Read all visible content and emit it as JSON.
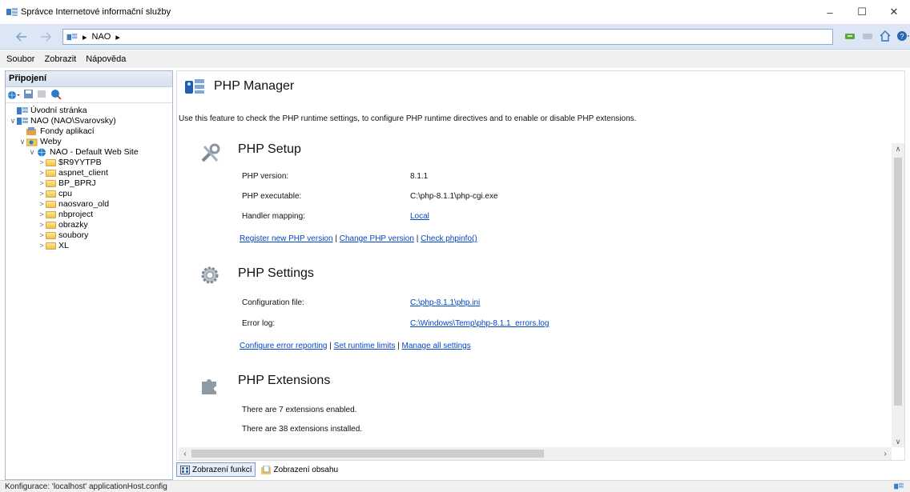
{
  "window": {
    "title": "Správce Internetové informační služby",
    "controls": {
      "minimize": "–",
      "maximize": "☐",
      "close": "✕"
    }
  },
  "address": {
    "crumbs": [
      "NAO"
    ],
    "separator": "▸"
  },
  "menu": {
    "items": [
      "Soubor",
      "Zobrazit",
      "Nápověda"
    ]
  },
  "connections": {
    "header": "Připojení",
    "tree": [
      {
        "label": "Úvodní stránka",
        "level": 0,
        "arrow": "",
        "icon": "start-page-icon"
      },
      {
        "label": "NAO (NAO\\Svarovsky)",
        "level": 0,
        "arrow": "∨",
        "icon": "server-icon"
      },
      {
        "label": "Fondy aplikací",
        "level": 1,
        "arrow": "",
        "icon": "app-pools-icon"
      },
      {
        "label": "Weby",
        "level": 1,
        "arrow": "∨",
        "icon": "sites-icon"
      },
      {
        "label": "NAO - Default Web Site",
        "level": 2,
        "arrow": "∨",
        "icon": "globe-icon"
      },
      {
        "label": "$R9YYTPB",
        "level": 3,
        "arrow": ">",
        "icon": "folder-icon"
      },
      {
        "label": "aspnet_client",
        "level": 3,
        "arrow": ">",
        "icon": "folder-icon"
      },
      {
        "label": "BP_BPRJ",
        "level": 3,
        "arrow": ">",
        "icon": "folder-icon"
      },
      {
        "label": "cpu",
        "level": 3,
        "arrow": ">",
        "icon": "folder-icon"
      },
      {
        "label": "naosvaro_old",
        "level": 3,
        "arrow": ">",
        "icon": "folder-icon"
      },
      {
        "label": "nbproject",
        "level": 3,
        "arrow": ">",
        "icon": "folder-icon"
      },
      {
        "label": "obrazky",
        "level": 3,
        "arrow": ">",
        "icon": "folder-icon"
      },
      {
        "label": "soubory",
        "level": 3,
        "arrow": ">",
        "icon": "folder-icon"
      },
      {
        "label": "XL",
        "level": 3,
        "arrow": ">",
        "icon": "folder-icon"
      }
    ]
  },
  "main": {
    "title": "PHP Manager",
    "description": "Use this feature to check the PHP runtime settings, to configure PHP runtime directives and to enable or disable PHP extensions.",
    "setup": {
      "title": "PHP Setup",
      "version_label": "PHP version:",
      "version_value": "8.1.1",
      "exec_label": "PHP executable:",
      "exec_value": "C:\\php-8.1.1\\php-cgi.exe",
      "handler_label": "Handler mapping:",
      "handler_value": "Local",
      "link_register": "Register new PHP version",
      "link_change": "Change PHP version",
      "link_phpinfo": "Check phpinfo()",
      "sep": "|"
    },
    "settings": {
      "title": "PHP Settings",
      "config_label": "Configuration file:",
      "config_value": "C:\\php-8.1.1\\php.ini",
      "errorlog_label": "Error log:",
      "errorlog_value": "C:\\Windows\\Temp\\php-8.1.1_errors.log",
      "link_error_reporting": "Configure error reporting",
      "link_runtime_limits": "Set runtime limits",
      "link_manage_all": "Manage all settings",
      "sep": "|"
    },
    "extensions": {
      "title": "PHP Extensions",
      "enabled_text": "There are 7 extensions enabled.",
      "installed_text": "There are 38 extensions installed."
    }
  },
  "view_tabs": {
    "features": "Zobrazení funkcí",
    "content": "Zobrazení obsahu"
  },
  "status": {
    "text": "Konfigurace: 'localhost' applicationHost.config"
  },
  "colors": {
    "link": "#0046c8",
    "address_bg": "#dce6f4"
  }
}
